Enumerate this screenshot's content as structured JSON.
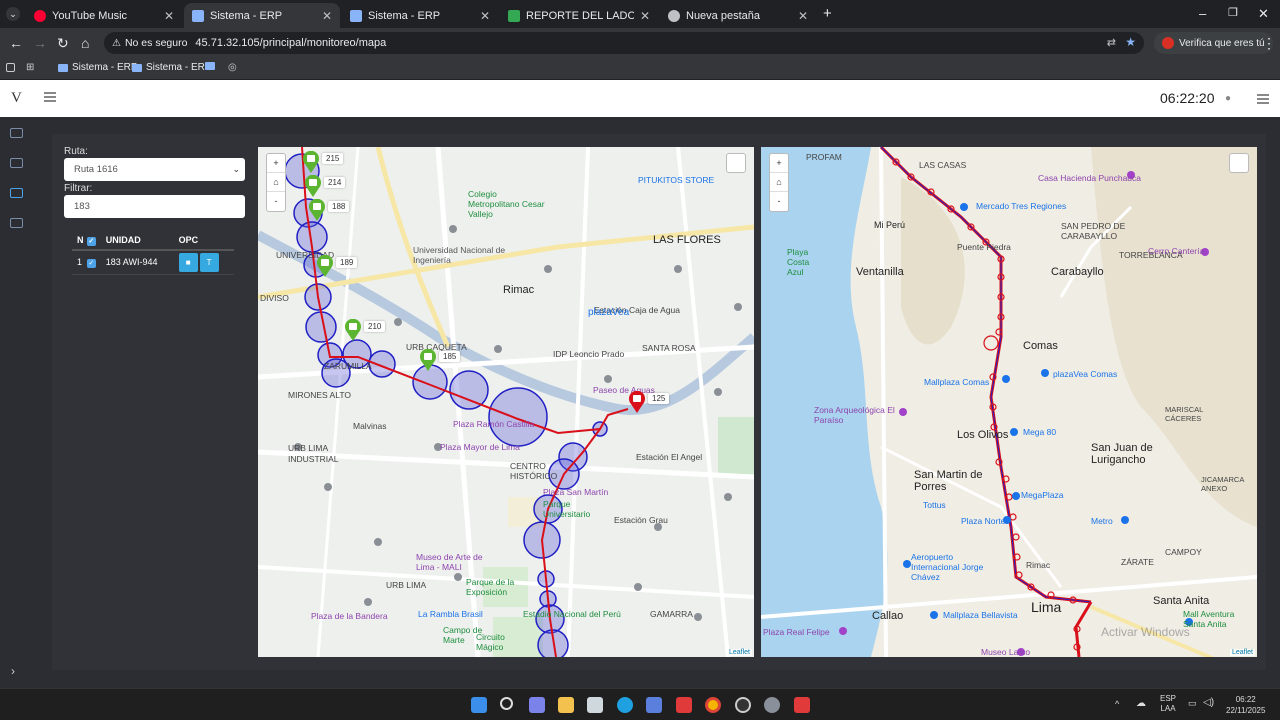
{
  "browser": {
    "tabs": [
      {
        "label": "YouTube Music",
        "color": "#ff0033"
      },
      {
        "label": "Sistema - ERP",
        "color": "#8ab4f8"
      },
      {
        "label": "Sistema - ERP",
        "color": "#8ab4f8"
      },
      {
        "label": "REPORTE DEL LADO A VIPUSA",
        "color": "#34a853"
      },
      {
        "label": "Nueva pestaña",
        "color": "#bdc1c6"
      }
    ],
    "insecure_label": "No es seguro",
    "url": "45.71.32.105/principal/monitoreo/mapa",
    "verify_label": "Verifica que eres tú",
    "bookmarks": [
      "Sistema - ERP",
      "Sistema - ERP"
    ]
  },
  "app": {
    "logo": "V",
    "clock": "06:22:20"
  },
  "filters": {
    "route_label": "Ruta:",
    "route_value": "Ruta 1616",
    "filter_label": "Filtrar:",
    "filter_value": "183"
  },
  "table": {
    "headers": [
      "N",
      "UNIDAD",
      "OPC"
    ],
    "rows": [
      {
        "n": "1",
        "unidad": "183 AWI-944",
        "opc_track": "bus-icon",
        "opc_t": "T"
      }
    ]
  },
  "map1": {
    "zoom_in": "+",
    "zoom_home": "home-icon",
    "zoom_out": "-",
    "attribution": "Leaflet",
    "vehicles": [
      "215",
      "214",
      "188",
      "189",
      "210",
      "185",
      "125"
    ],
    "labels": [
      "PITUKITOS STORE",
      "Colegio Metropolitano Cesar Vallejo",
      "Universidad Nacional de Ingeniería",
      "LAS FLORES",
      "Rimac",
      "Estación Caja de Agua",
      "SANTA ROSA",
      "IDP Leoncio Prado",
      "plazaVea",
      "Paseo de Aguas",
      "MIRONES ALTO",
      "ZARUMILLA",
      "Malvinas",
      "Plaza Ramón Castilla",
      "Plaza Mayor de Lima",
      "URB LIMA INDUSTRIAL",
      "CENTRO HISTÓRICO",
      "Parque Universitario",
      "Plaza San Martín",
      "Estación El Angel",
      "Estación Grau",
      "Museo de Arte de Lima - MALI",
      "Parque de la Exposición",
      "URB LIMA",
      "Plaza de la Bandera",
      "La Rambla Brasil",
      "Campo de Marte",
      "Estadio Nacional del Perú",
      "Circuito Mágico",
      "GAMARRA",
      "URB CAQUETA",
      "DIVISO",
      "UNIVERSIDAD"
    ]
  },
  "map2": {
    "zoom_in": "+",
    "zoom_home": "home-icon",
    "zoom_out": "-",
    "attribution": "Leaflet",
    "watermark": "Activar Windows",
    "labels": [
      "PROFAM",
      "LAS CASAS",
      "Casa Hacienda Punchauca",
      "Mercado Tres Regiones",
      "Mi Perú",
      "Puente Piedra",
      "SAN PEDRO DE CARABAYLLO",
      "TORREBLANCA",
      "Playa Costa Azul",
      "Ventanilla",
      "Carabayllo",
      "Cerro Cantería",
      "Comas",
      "plazaVea Comas",
      "Mallplaza Comas",
      "Zona Arqueológica El Paraíso",
      "Los Olivos",
      "Mega 80",
      "San Juan de Lurigancho",
      "San Martin de Porres",
      "MegaPlaza",
      "Tottus",
      "Plaza Norte",
      "Metro",
      "Aeropuerto Internacional Jorge Chávez",
      "Rimac",
      "CAMPOY",
      "ZÁRATE",
      "Callao",
      "Mallplaza Bellavista",
      "Lima",
      "Santa Anita",
      "Mall Aventura Santa Anita",
      "Plaza Real Felipe",
      "Museo Larco",
      "JICAMARCA ANEXO",
      "MARISCAL CÁCERES"
    ]
  },
  "taskbar": {
    "lang": "ESP",
    "lang2": "LAA",
    "time": "06:22",
    "date": "22/11/2025"
  }
}
